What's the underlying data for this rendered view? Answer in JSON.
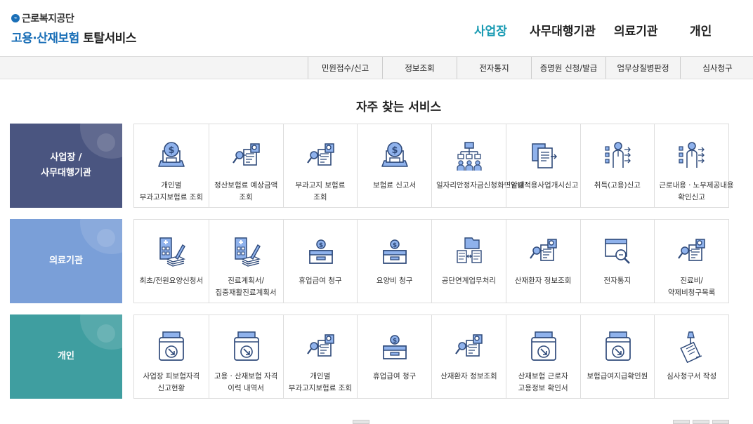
{
  "logo": {
    "top": "근로복지공단",
    "main_blue": "고용·산재보험",
    "main_dark": "토탈서비스"
  },
  "gnb": [
    "사업장",
    "사무대행기관",
    "의료기관",
    "개인"
  ],
  "subnav": [
    "민원접수/신고",
    "정보조회",
    "전자통지",
    "증명원 신청/발급",
    "업무상질병판정",
    "심사청구"
  ],
  "section_title": "자주 찾는 서비스",
  "colors": {
    "accent": "#1a9bb3",
    "row1": "#4a5580",
    "row2": "#7a9fd8",
    "row3": "#3f9ea0",
    "icon_line": "#2f4a7a",
    "icon_fill": "#8fb2ec"
  },
  "rows": [
    {
      "category": [
        "사업장 /",
        "사무대행기관"
      ],
      "items": [
        {
          "label": "개인별 부과고지보험료 조회",
          "icon": "coin-monitor-icon"
        },
        {
          "label": "정산보험료 예상금액 조회",
          "icon": "document-search-icon"
        },
        {
          "label": "부과고지 보험료 조회",
          "icon": "document-search-icon"
        },
        {
          "label": "보험료 신고서",
          "icon": "coin-monitor-icon"
        },
        {
          "label": "일자리안정자금신청화면안내",
          "icon": "org-chart-people-icon"
        },
        {
          "label": "일괄적용사업개시신고",
          "icon": "documents-arrow-icon"
        },
        {
          "label": "취득(고용)신고",
          "icon": "person-list-icon"
        },
        {
          "label": "근로내용ㆍ노무제공내용 확인신고",
          "icon": "person-list-icon"
        }
      ]
    },
    {
      "category": [
        "의료기관"
      ],
      "items": [
        {
          "label": "최초/전원요양신청서",
          "icon": "hospital-papers-icon"
        },
        {
          "label": "진료계획서/집중재활진료계획서",
          "icon": "hospital-papers-icon"
        },
        {
          "label": "휴업급여 청구",
          "icon": "coin-box-icon"
        },
        {
          "label": "요양비 청구",
          "icon": "coin-box-icon"
        },
        {
          "label": "공단연계업무처리",
          "icon": "folders-transfer-icon"
        },
        {
          "label": "산재환자 정보조회",
          "icon": "document-search-icon"
        },
        {
          "label": "전자통지",
          "icon": "box-magnifier-icon"
        },
        {
          "label": "진료비/약제비청구목록",
          "icon": "document-search-icon"
        }
      ]
    },
    {
      "category": [
        "개인"
      ],
      "items": [
        {
          "label": "사업장 피보험자격 신고현황",
          "icon": "printer-arrow-icon"
        },
        {
          "label": "고용ㆍ산재보험 자격 이력 내역서",
          "icon": "printer-arrow-icon"
        },
        {
          "label": "개인별 부과고지보험료 조회",
          "icon": "document-search-icon"
        },
        {
          "label": "휴업급여 청구",
          "icon": "coin-box-icon"
        },
        {
          "label": "산재환자 정보조회",
          "icon": "document-search-icon"
        },
        {
          "label": "산재보험 근로자 고용정보 확인서",
          "icon": "printer-arrow-icon"
        },
        {
          "label": "보험급여지급확인원",
          "icon": "printer-arrow-icon"
        },
        {
          "label": "심사청구서 작성",
          "icon": "pen-document-icon"
        }
      ]
    }
  ]
}
